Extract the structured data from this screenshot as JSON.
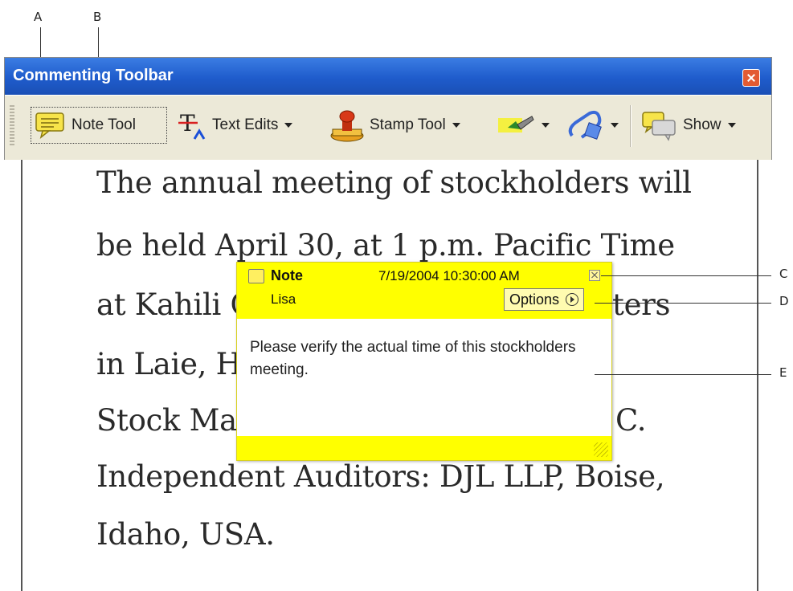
{
  "callouts": {
    "a": "A",
    "b": "B",
    "c": "C",
    "d": "D",
    "e": "E"
  },
  "toolbar": {
    "title": "Commenting Toolbar",
    "note_tool": "Note Tool",
    "text_edits": "Text Edits",
    "stamp_tool": "Stamp Tool",
    "show": "Show"
  },
  "document": {
    "lines": [
      "The annual meeting of stockholders will",
      "be held April 30, at 1 p.m. Pacific Time",
      "at Kahili Cou",
      "in Laie, H",
      "Stock Mar",
      "Independent Auditors: DJL LLP, Boise,",
      "Idaho, USA."
    ],
    "right_fragments": [
      "ters",
      "C."
    ]
  },
  "note": {
    "title": "Note",
    "author": "Lisa",
    "date": "7/19/2004 10:30:00 AM",
    "options_label": "Options",
    "body": "Please verify the actual time of this stockholders meeting."
  },
  "colors": {
    "titlebar": "#1f5ccc",
    "toolbar_bg": "#ece9d8",
    "note_yellow": "#ffff00"
  }
}
